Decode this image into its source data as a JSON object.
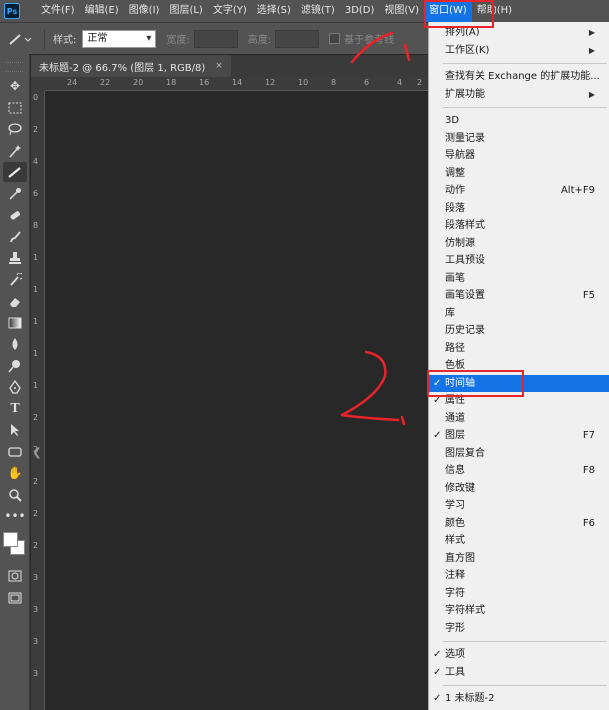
{
  "app": {
    "logo": "Ps"
  },
  "menubar": {
    "items": [
      "文件(F)",
      "编辑(E)",
      "图像(I)",
      "图层(L)",
      "文字(Y)",
      "选择(S)",
      "滤镜(T)",
      "3D(D)",
      "视图(V)",
      "窗口(W)",
      "帮助(H)"
    ]
  },
  "options": {
    "style_label": "样式:",
    "style_value": "正常",
    "width_label": "宽度:",
    "height_label": "高度:",
    "guides_label": "基于参考线"
  },
  "document": {
    "tab_title": "未标题-2 @ 66.7% (图层 1, RGB/8)",
    "close_glyph": "×"
  },
  "ruler_h": [
    "24",
    "22",
    "20",
    "18",
    "16",
    "14",
    "12",
    "10",
    "8",
    "6",
    "4",
    "2"
  ],
  "ruler_v": [
    "0",
    "2",
    "4",
    "6",
    "8",
    "1",
    "1",
    "1",
    "1",
    "1",
    "2",
    "2",
    "2",
    "2",
    "2",
    "3",
    "3",
    "3",
    "3"
  ],
  "window_menu": {
    "group1": [
      {
        "label": "排列(A)",
        "submenu": true
      },
      {
        "label": "工作区(K)",
        "submenu": true
      }
    ],
    "group2": [
      {
        "label": "查找有关 Exchange 的扩展功能...",
        "submenu": false
      },
      {
        "label": "扩展功能",
        "submenu": true
      }
    ],
    "group3": [
      {
        "label": "3D",
        "shortcut": ""
      },
      {
        "label": "测量记录",
        "shortcut": ""
      },
      {
        "label": "导航器",
        "shortcut": ""
      },
      {
        "label": "调整",
        "shortcut": ""
      },
      {
        "label": "动作",
        "shortcut": "Alt+F9"
      },
      {
        "label": "段落",
        "shortcut": ""
      },
      {
        "label": "段落样式",
        "shortcut": ""
      },
      {
        "label": "仿制源",
        "shortcut": ""
      },
      {
        "label": "工具预设",
        "shortcut": ""
      },
      {
        "label": "画笔",
        "shortcut": ""
      },
      {
        "label": "画笔设置",
        "shortcut": "F5"
      },
      {
        "label": "库",
        "shortcut": ""
      },
      {
        "label": "历史记录",
        "shortcut": ""
      },
      {
        "label": "路径",
        "shortcut": ""
      },
      {
        "label": "色板",
        "shortcut": ""
      },
      {
        "label": "时间轴",
        "shortcut": "",
        "checked": true,
        "highlighted": true
      },
      {
        "label": "属性",
        "shortcut": "",
        "checked": true
      },
      {
        "label": "通道",
        "shortcut": ""
      },
      {
        "label": "图层",
        "shortcut": "F7",
        "checked": true
      },
      {
        "label": "图层复合",
        "shortcut": ""
      },
      {
        "label": "信息",
        "shortcut": "F8"
      },
      {
        "label": "修改键",
        "shortcut": ""
      },
      {
        "label": "学习",
        "shortcut": ""
      },
      {
        "label": "颜色",
        "shortcut": "F6"
      },
      {
        "label": "样式",
        "shortcut": ""
      },
      {
        "label": "直方图",
        "shortcut": ""
      },
      {
        "label": "注释",
        "shortcut": ""
      },
      {
        "label": "字符",
        "shortcut": ""
      },
      {
        "label": "字符样式",
        "shortcut": ""
      },
      {
        "label": "字形",
        "shortcut": ""
      }
    ],
    "group4": [
      {
        "label": "选项",
        "checked": true
      },
      {
        "label": "工具",
        "checked": true
      }
    ],
    "group5": [
      {
        "label": "1 未标题-2",
        "checked": true
      }
    ]
  },
  "icons": {
    "tools": [
      "move-icon",
      "marquee-icon",
      "lasso-icon",
      "magic-wand-icon",
      "ruler-tool-icon",
      "eyedropper-icon",
      "healing-brush-icon",
      "brush-icon",
      "clone-stamp-icon",
      "history-brush-icon",
      "eraser-icon",
      "gradient-icon",
      "blur-icon",
      "dodge-icon",
      "pen-icon",
      "type-icon",
      "path-select-icon",
      "rectangle-icon",
      "hand-icon",
      "zoom-icon",
      "more-tools-icon"
    ],
    "check": "✓",
    "submenu": "▶"
  },
  "colors": {
    "highlight": "#1473e6",
    "annotation": "#e8232a",
    "menubar": "#535353",
    "canvas": "#282828"
  }
}
